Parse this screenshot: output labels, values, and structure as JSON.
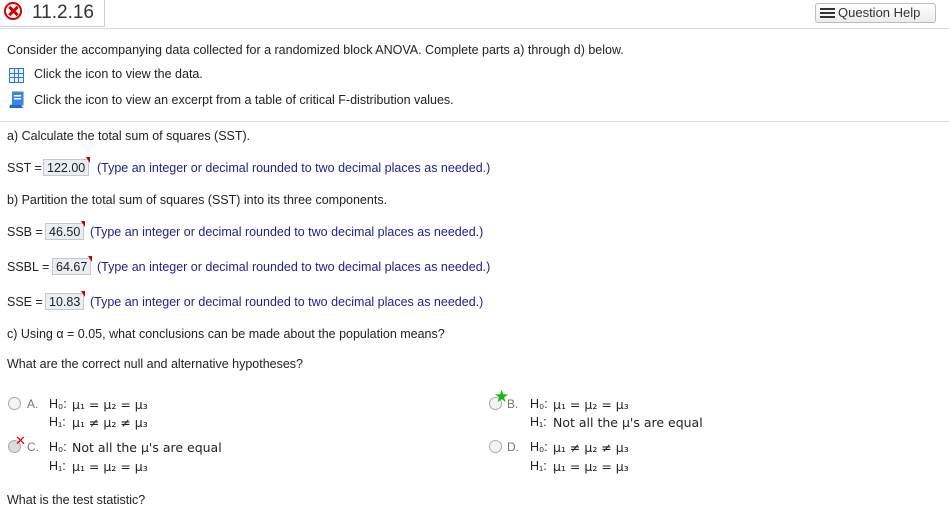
{
  "header": {
    "problem_number": "11.2.16",
    "help_label": "Question Help"
  },
  "intro": {
    "text": "Consider the accompanying data collected for a randomized block ANOVA. Complete parts a) through d) below.",
    "data_link": "Click the icon to view the data.",
    "table_link": "Click the icon to view an excerpt from a table of critical F-distribution values."
  },
  "part_a": {
    "question": "a) Calculate the total sum of squares (SST).",
    "label": "SST =",
    "value": "122.00",
    "hint": "(Type an integer or decimal rounded to two decimal places as needed.)"
  },
  "part_b": {
    "question": "b) Partition the total sum of squares (SST) into its three components.",
    "ssb": {
      "label": "SSB =",
      "value": "46.50",
      "hint": "(Type an integer or decimal rounded to two decimal places as needed.)"
    },
    "ssbl": {
      "label": "SSBL =",
      "value": "64.67",
      "hint": "(Type an integer or decimal rounded to two decimal places as needed.)"
    },
    "sse": {
      "label": "SSE =",
      "value": "10.83",
      "hint": "(Type an integer or decimal rounded to two decimal places as needed.)"
    }
  },
  "part_c": {
    "question": "c) Using α = 0.05, what conclusions can be made about the population means?",
    "hypotheses_question": "What are the correct null and alternative hypotheses?",
    "options": [
      {
        "letter": "A.",
        "h0": "μ₁ = μ₂ = μ₃",
        "h1": "μ₁ ≠ μ₂ ≠ μ₃",
        "state": "unselected"
      },
      {
        "letter": "B.",
        "h0": "μ₁ = μ₂ = μ₃",
        "h1": "Not all the μ's are equal",
        "state": "correct"
      },
      {
        "letter": "C.",
        "h0": "Not all the μ's are equal",
        "h1": "μ₁ = μ₂ = μ₃",
        "state": "incorrect-selected"
      },
      {
        "letter": "D.",
        "h0": "μ₁ ≠ μ₂ ≠ μ₃",
        "h1": "μ₁ = μ₂ = μ₃",
        "state": "unselected"
      }
    ],
    "h0_label": "H₀:",
    "h1_label": "H₁:",
    "test_statistic_question": "What is the test statistic?"
  },
  "colors": {
    "incorrect": "#d40000",
    "correct_star": "#14b814",
    "hint_text": "#1f1f8a",
    "answer_box_bg": "#e9eef4"
  },
  "icons": [
    "close-x-icon",
    "list-icon",
    "data-table-icon",
    "book-icon",
    "green-star-icon",
    "red-x-mark-icon"
  ]
}
